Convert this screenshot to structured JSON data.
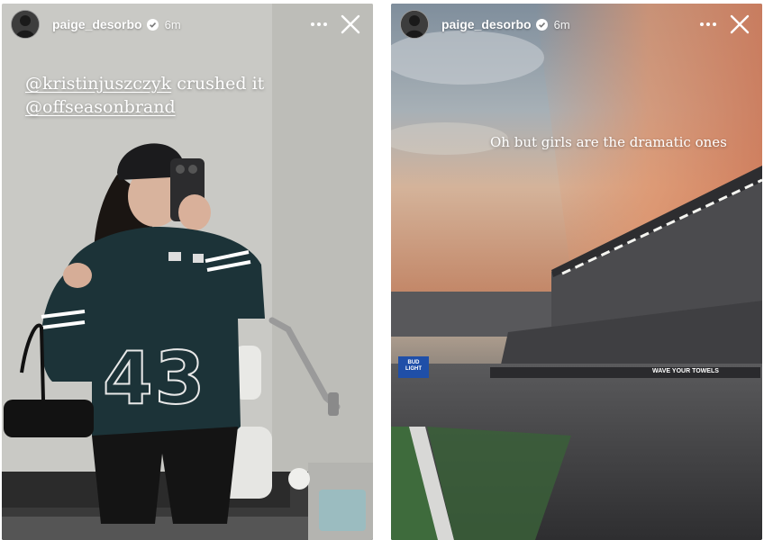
{
  "stories": [
    {
      "header": {
        "username": "paige_desorbo",
        "time": "6m",
        "avatar_icon": "profile-photo",
        "verified_icon": "verified-badge-icon",
        "more_icon": "more-horizontal-icon",
        "close_icon": "close-icon"
      },
      "caption": {
        "line1_mention": "@kristinjuszczyk",
        "line1_text": " crushed it",
        "line2_mention": "@offseasonbrand"
      },
      "jacket_number": "43"
    },
    {
      "header": {
        "username": "paige_desorbo",
        "time": "6m",
        "avatar_icon": "profile-photo",
        "verified_icon": "verified-badge-icon",
        "more_icon": "more-horizontal-icon",
        "close_icon": "close-icon"
      },
      "caption": {
        "text": "Oh but girls are the dramatic ones"
      },
      "stadium_signs": {
        "sign1": "BUD LIGHT",
        "sign2": "WAVE YOUR TOWELS"
      }
    }
  ],
  "colors": {
    "jacket": "#1c3338",
    "verified": "#3897f0",
    "sunset": "#e0936b"
  }
}
